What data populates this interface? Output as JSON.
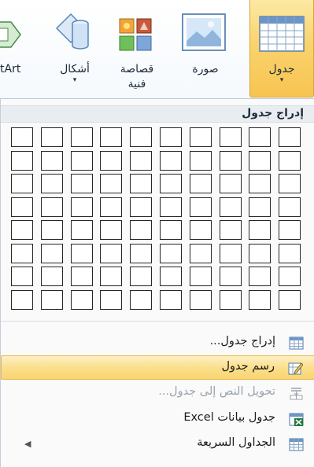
{
  "ribbon": {
    "buttons": [
      {
        "id": "table",
        "label": "جدول",
        "has_dropdown": true
      },
      {
        "id": "picture",
        "label": "صورة",
        "has_dropdown": false
      },
      {
        "id": "clipart",
        "label_line1": "قصاصة",
        "label_line2": "فنية",
        "has_dropdown": false
      },
      {
        "id": "shapes",
        "label": "أشكال",
        "has_dropdown": true
      },
      {
        "id": "smartart",
        "label": "tArt",
        "has_dropdown": false
      }
    ],
    "dropdown_arrow": "▾"
  },
  "menu": {
    "grid_title": "إدراج جدول",
    "grid_cols": 10,
    "grid_rows": 8,
    "items": [
      {
        "id": "insert-table",
        "label": "إدراج جدول...",
        "icon": "table-icon",
        "disabled": false,
        "highlighted": false
      },
      {
        "id": "draw-table",
        "label": "رسم جدول",
        "icon": "pencil-table-icon",
        "disabled": false,
        "highlighted": true
      },
      {
        "id": "convert-text",
        "label": "تحويل النص إلى جدول...",
        "icon": "convert-text-icon",
        "disabled": true,
        "highlighted": false
      },
      {
        "id": "excel-table",
        "label": "جدول بيانات Excel",
        "icon": "excel-icon",
        "disabled": false,
        "highlighted": false
      },
      {
        "id": "quick-tables",
        "label": "الجداول السريعة",
        "icon": "quick-tables-icon",
        "disabled": false,
        "highlighted": false,
        "submenu_arrow": "◀"
      }
    ]
  },
  "colors": {
    "highlight": "#f9d571",
    "highlight_border": "#e8b94b",
    "grid_border": "#262626",
    "excel_green": "#1f7a3a"
  }
}
